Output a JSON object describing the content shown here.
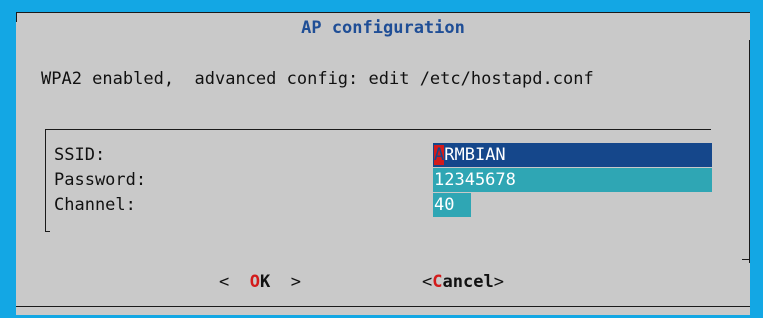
{
  "dialog": {
    "title": "AP configuration",
    "info": "WPA2 enabled,  advanced config: edit /etc/hostapd.conf"
  },
  "form": {
    "fields": [
      {
        "label": "SSID:",
        "value_first": "A",
        "value_rest": "RMBIAN"
      },
      {
        "label": "Password:",
        "value": "12345678"
      },
      {
        "label": "Channel:",
        "value": "40"
      }
    ]
  },
  "buttons": {
    "ok": {
      "left": "<  ",
      "hotkey": "O",
      "rest": "K",
      "right": "  >"
    },
    "cancel": {
      "left": "<",
      "hotkey": "C",
      "rest": "ancel",
      "right": ">"
    }
  },
  "colors": {
    "background": "#13a7e4",
    "dialog": "#c9c9c9",
    "title": "#1f4e96",
    "field_selected": "#15478b",
    "field": "#2fa6b4",
    "hotkey": "#d31b1b"
  }
}
